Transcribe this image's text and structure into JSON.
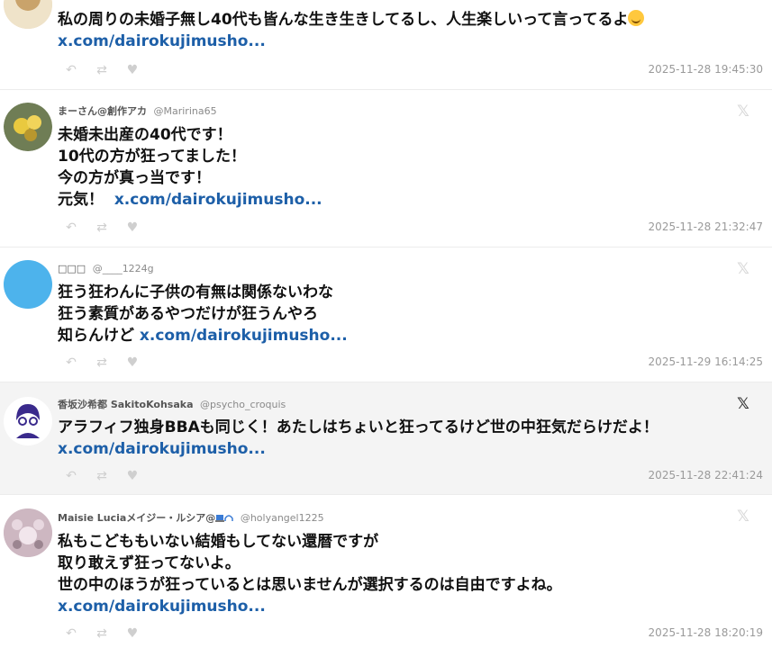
{
  "tweets": [
    {
      "display_name": "",
      "handle": "",
      "lines": [
        "私の周りの未婚子無し40代も皆んな生き生きしてるし、人生楽しいって言ってるよ"
      ],
      "link": "x.com/dairokujimusho...",
      "timestamp": "2025-11-28 19:45:30"
    },
    {
      "display_name": "まーさん@創作アカ",
      "handle": "@Maririna65",
      "lines": [
        "未婚未出産の40代です！",
        "10代の方が狂ってました！",
        "今の方が真っ当です！",
        "元気！"
      ],
      "link": "x.com/dairokujimusho...",
      "timestamp": "2025-11-28 21:32:47"
    },
    {
      "display_name": "□□□",
      "handle": "@____1224g",
      "lines": [
        "狂う狂わんに子供の有無は関係ないわな",
        "狂う素質があるやつだけが狂うんやろ",
        "知らんけど"
      ],
      "link": "x.com/dairokujimusho...",
      "timestamp": "2025-11-29 16:14:25"
    },
    {
      "display_name": "香坂沙希都 SakitoKohsaka",
      "handle": "@psycho_croquis",
      "lines": [
        "アラフィフ独身BBAも同じく！あたしはちょいと狂ってるけど世の中狂気だらけだよ！"
      ],
      "link": "x.com/dairokujimusho...",
      "timestamp": "2025-11-28 22:41:24"
    },
    {
      "display_name": "Maisie Luciaメイジー・ルシア@",
      "handle": "@holyangel1225",
      "lines": [
        "私もこどももいない結婚もしてない還暦ですが",
        "取り敢えず狂ってないよ。",
        "世の中のほうが狂っているとは思いませんが選択するのは自由ですよね。"
      ],
      "link": "x.com/dairokujimusho...",
      "timestamp": "2025-11-28 18:20:19"
    }
  ],
  "icons": {
    "x_logo": "𝕏",
    "reply": "↶",
    "retweet": "⇄",
    "like": "♥"
  },
  "colors": {
    "link": "#1d5fa8",
    "highlight_bg": "#f4f4f4",
    "avatar_blue": "#4db3ec"
  }
}
